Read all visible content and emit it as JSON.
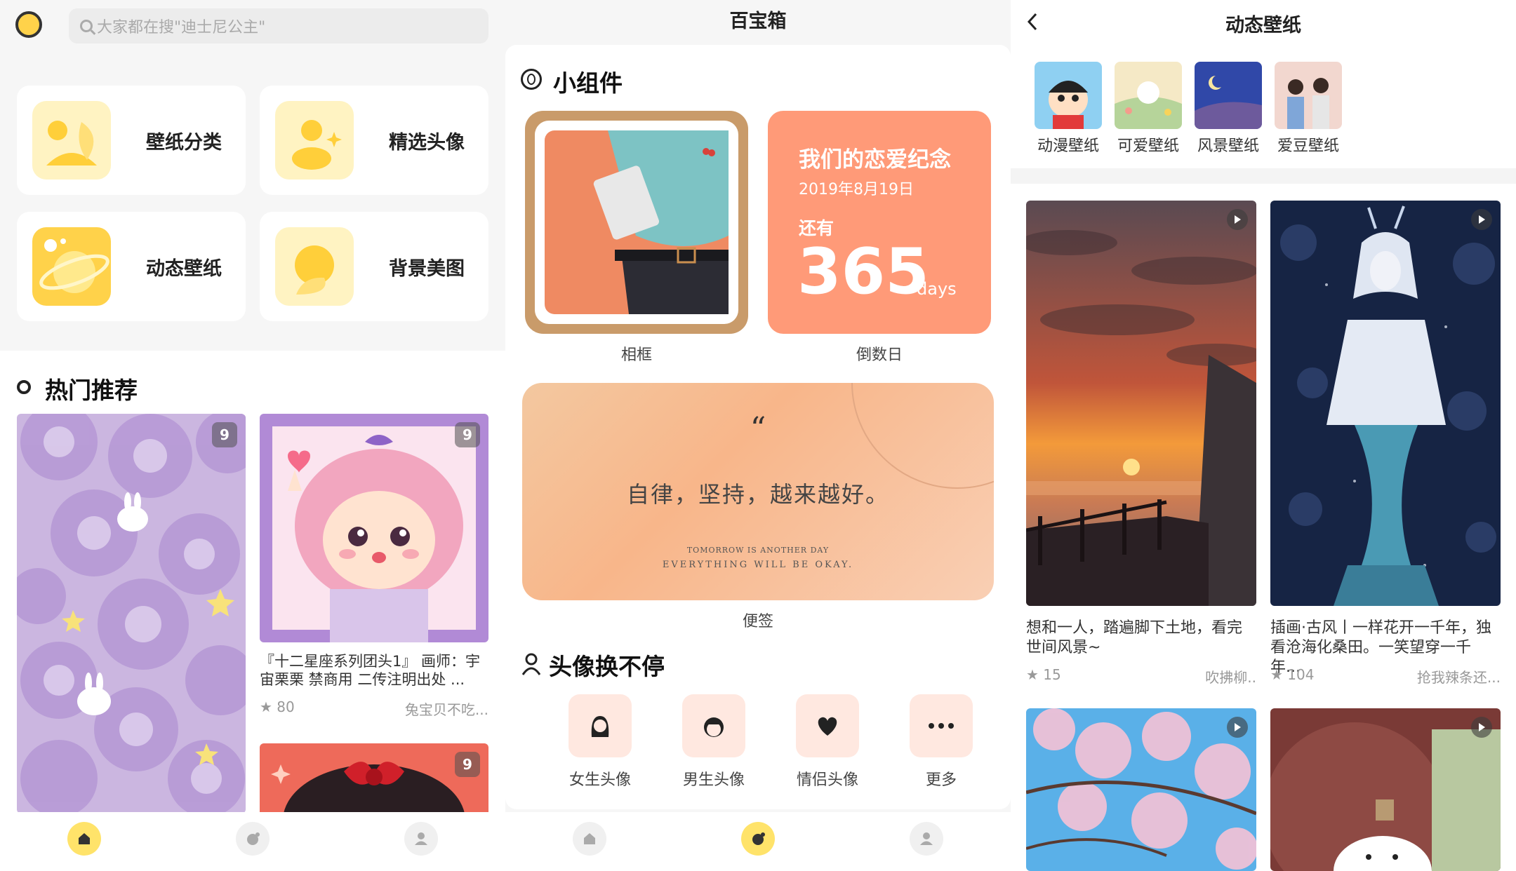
{
  "panel1": {
    "search_placeholder": "大家都在搜\"迪士尼公主\"",
    "categories": [
      {
        "label": "壁纸分类",
        "icon": "sun-leaf-icon"
      },
      {
        "label": "精选头像",
        "icon": "user-sparkle-icon"
      },
      {
        "label": "动态壁纸",
        "icon": "planet-icon"
      },
      {
        "label": "背景美图",
        "icon": "chat-bubble-icon"
      }
    ],
    "section_title": "热门推荐",
    "cards": [
      {
        "badge": "9"
      },
      {
        "badge": "9",
        "title": "『十二星座系列团头1』 画师：宇宙栗栗 禁商用 二传注明出处 ...",
        "likes": "80",
        "author": "兔宝贝不吃..."
      },
      {
        "badge": "9"
      }
    ]
  },
  "panel2": {
    "title": "百宝箱",
    "widgets_title": "小组件",
    "frame_label": "相框",
    "countdown": {
      "heading": "我们的恋爱纪念",
      "date": "2019年8月19日",
      "remaining": "还有",
      "number": "365",
      "unit": "days",
      "label": "倒数日"
    },
    "note": {
      "quote_mark": "“",
      "text": "自律，坚持，越来越好。",
      "line1": "TOMORROW IS ANOTHER DAY",
      "line2": "EVERYTHING WILL BE OKAY.",
      "label": "便签"
    },
    "avatar_title": "头像换不停",
    "avatars": [
      {
        "label": "女生头像",
        "icon": "girl-icon"
      },
      {
        "label": "男生头像",
        "icon": "boy-icon"
      },
      {
        "label": "情侣头像",
        "icon": "heart-icon"
      },
      {
        "label": "更多",
        "icon": "more-icon"
      }
    ]
  },
  "panel3": {
    "title": "动态壁纸",
    "categories": [
      "动漫壁纸",
      "可爱壁纸",
      "风景壁纸",
      "爱豆壁纸"
    ],
    "feed": [
      {
        "title": "想和一人，踏遍脚下土地，看完世间风景~",
        "likes": "15",
        "author": "吹拂柳.."
      },
      {
        "title": "插画·古风丨一样花开一千年，独看沧海化桑田。一笑望穿一千年...",
        "likes": "104",
        "author": "抢我辣条还..."
      }
    ]
  },
  "colors": {
    "accent_yellow": "#ffd24a",
    "countdown_orange": "#ff9a78",
    "nav_active": "#ffe36a"
  }
}
